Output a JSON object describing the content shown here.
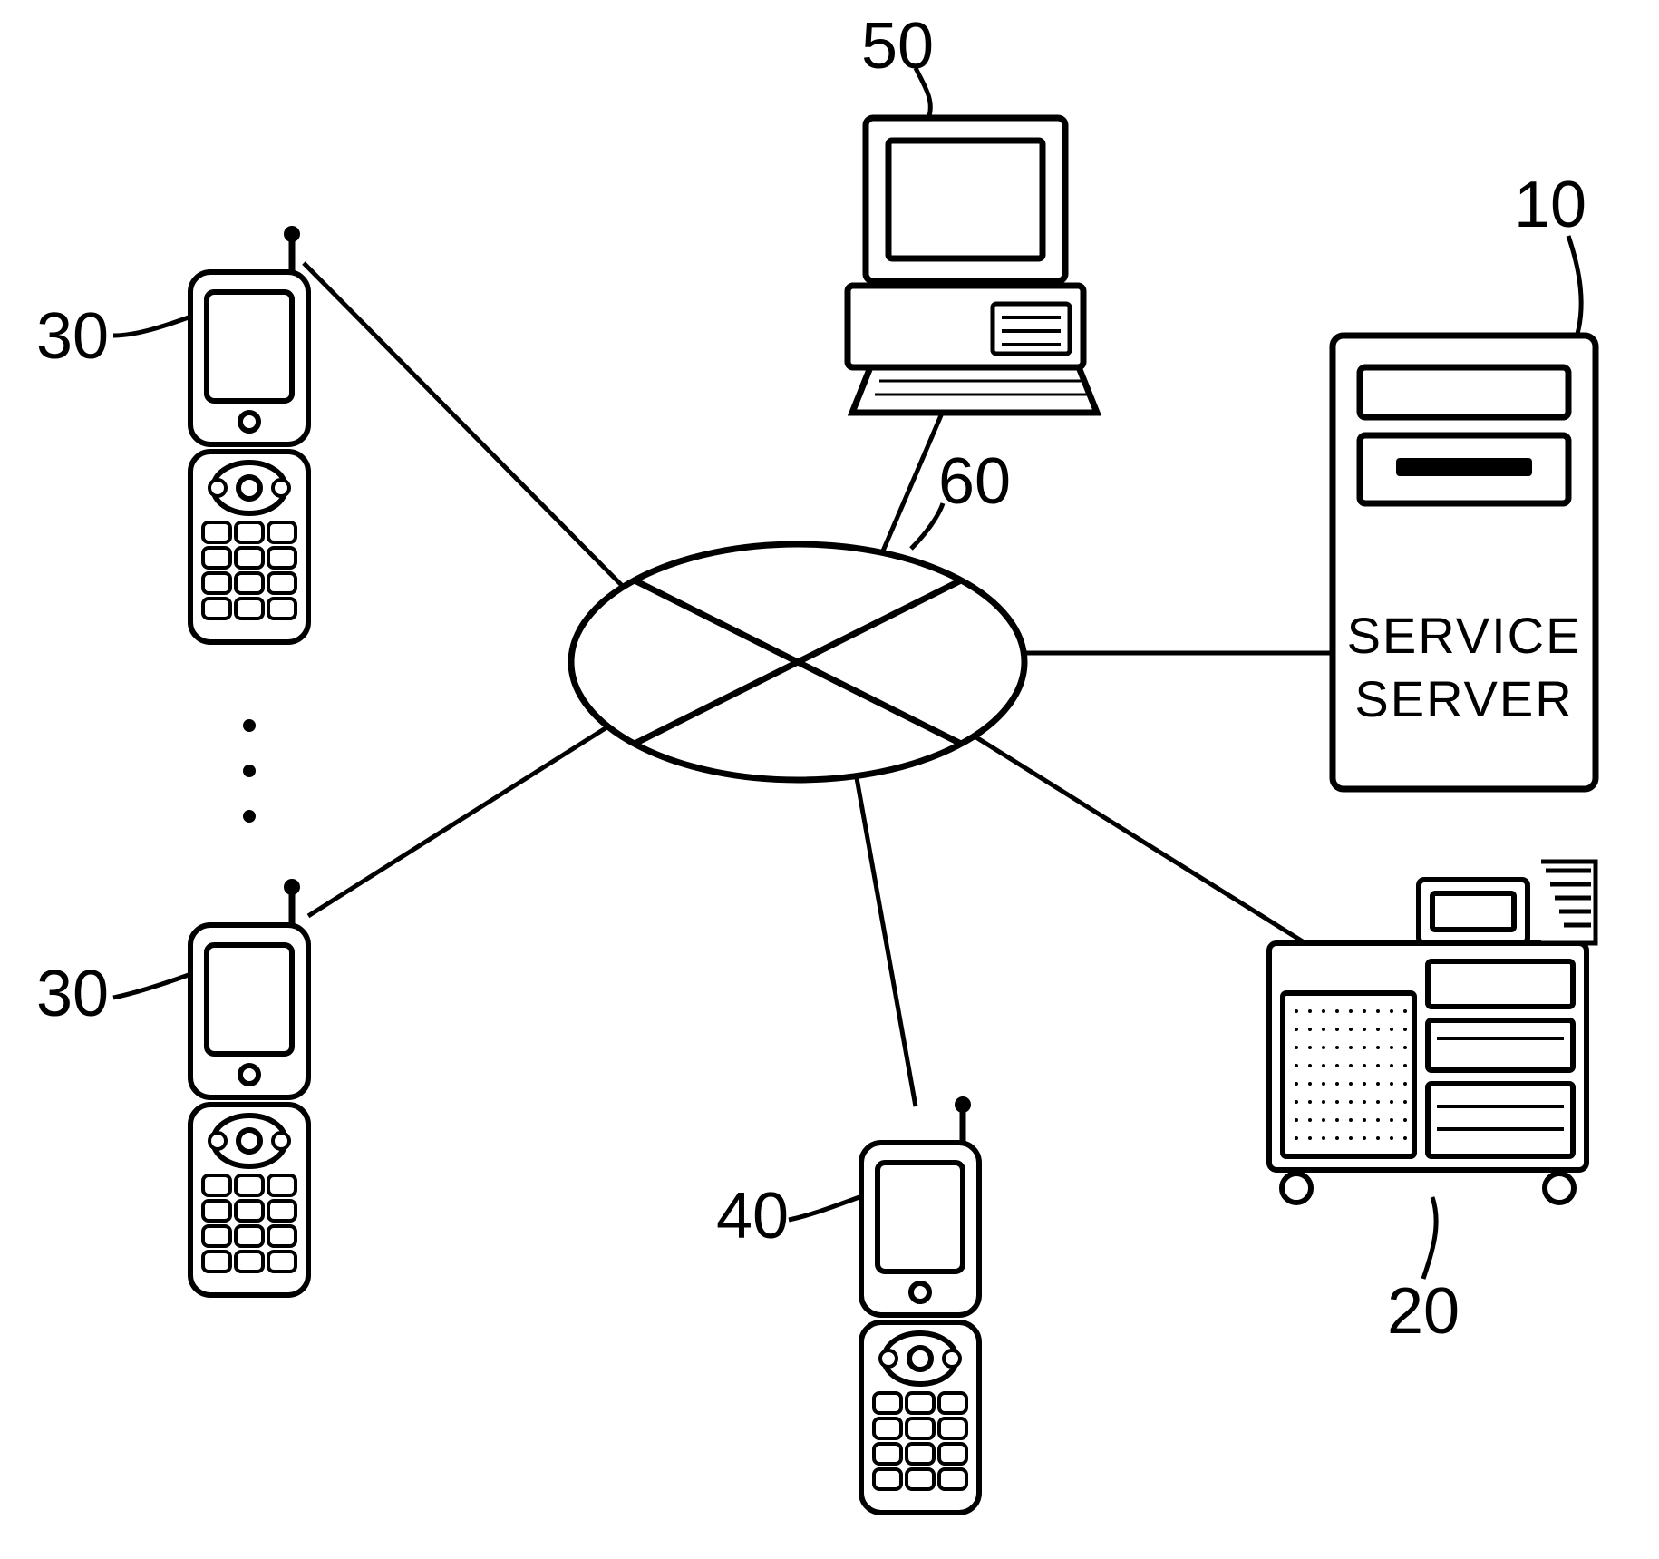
{
  "labels": {
    "server": "10",
    "printer": "20",
    "phone_upper": "30",
    "phone_lower": "30",
    "phone_bottom": "40",
    "computer": "50",
    "network": "60",
    "server_line1": "SERVICE",
    "server_line2": "SERVER"
  }
}
